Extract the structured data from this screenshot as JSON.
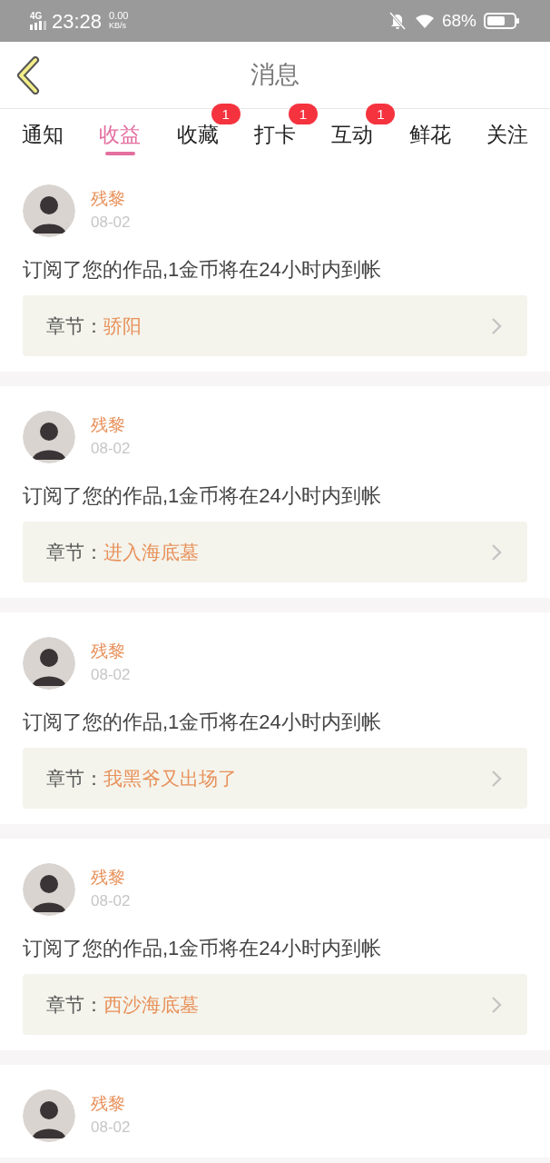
{
  "status_bar": {
    "network": "4G",
    "time": "23:28",
    "speed": "0.00",
    "speed_unit": "KB/s",
    "battery": "68%"
  },
  "header": {
    "title": "消息"
  },
  "tabs": [
    {
      "label": "通知",
      "selected": false
    },
    {
      "label": "收益",
      "selected": true
    },
    {
      "label": "收藏",
      "selected": false,
      "badge": "1"
    },
    {
      "label": "打卡",
      "selected": false,
      "badge": "1"
    },
    {
      "label": "互动",
      "selected": false,
      "badge": "1"
    },
    {
      "label": "鲜花",
      "selected": false
    },
    {
      "label": "关注",
      "selected": false
    }
  ],
  "messages": [
    {
      "name": "残黎",
      "date": "08-02",
      "text": "订阅了您的作品,1金币将在24小时内到帐",
      "chapter_label": "章节：",
      "chapter": "骄阳"
    },
    {
      "name": "残黎",
      "date": "08-02",
      "text": "订阅了您的作品,1金币将在24小时内到帐",
      "chapter_label": "章节：",
      "chapter": "进入海底墓"
    },
    {
      "name": "残黎",
      "date": "08-02",
      "text": "订阅了您的作品,1金币将在24小时内到帐",
      "chapter_label": "章节：",
      "chapter": "我黑爷又出场了"
    },
    {
      "name": "残黎",
      "date": "08-02",
      "text": "订阅了您的作品,1金币将在24小时内到帐",
      "chapter_label": "章节：",
      "chapter": "西沙海底墓"
    },
    {
      "name": "残黎",
      "date": "08-02"
    }
  ]
}
